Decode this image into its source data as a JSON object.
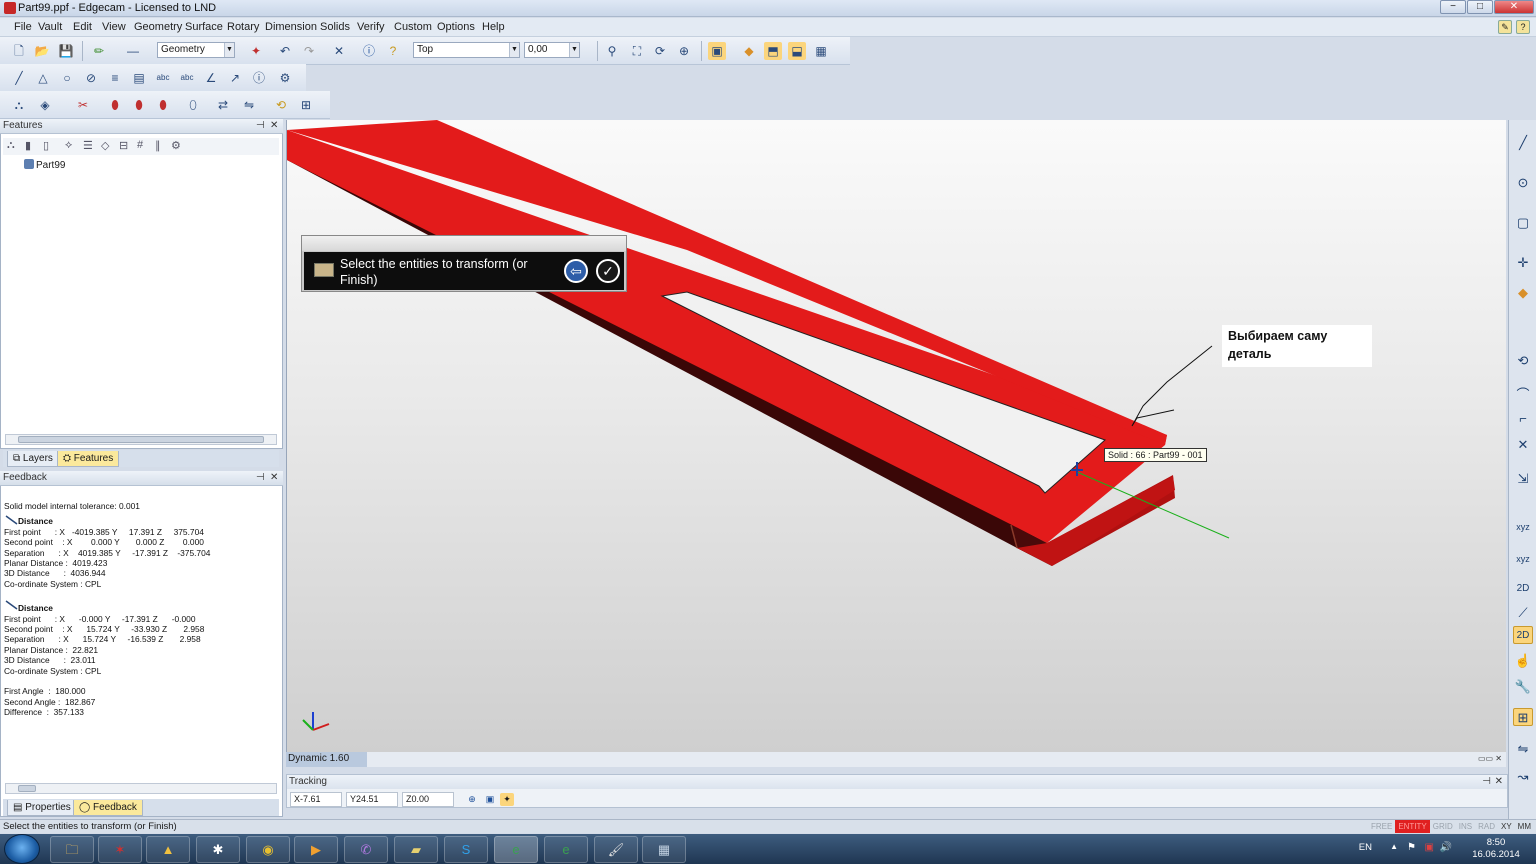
{
  "window": {
    "title": "Part99.ppf - Edgecam - Licensed to LND",
    "min": "−",
    "max": "□",
    "close": "✕"
  },
  "menu": [
    "File",
    "Vault",
    "Edit",
    "View",
    "Geometry",
    "Surface",
    "Rotary",
    "Dimension",
    "Solids",
    "Verify",
    "Custom",
    "Options",
    "Help"
  ],
  "toolbar": {
    "layer_select": "Geometry",
    "view_select": "Top",
    "depth_value": "0,00"
  },
  "features_panel": {
    "title": "Features",
    "tree_root": "Part99",
    "tabs": [
      "Layers",
      "Features"
    ]
  },
  "feedback_panel": {
    "title": "Feedback",
    "tolerance": "Solid model internal tolerance: 0.001",
    "block1": {
      "heading": "Distance",
      "lines": [
        "First point      : X   -4019.385 Y     17.391 Z     375.704",
        "Second point    : X        0.000 Y       0.000 Z        0.000",
        "Separation      : X    4019.385 Y     -17.391 Z    -375.704",
        "Planar Distance :  4019.423",
        "3D Distance      :  4036.944",
        "Co-ordinate System : CPL"
      ]
    },
    "block2": {
      "heading": "Distance",
      "lines": [
        "First point      : X      -0.000 Y     -17.391 Z      -0.000",
        "Second point    : X      15.724 Y     -33.930 Z       2.958",
        "Separation      : X      15.724 Y     -16.539 Z       2.958",
        "Planar Distance :  22.821",
        "3D Distance      :  23.011",
        "Co-ordinate System : CPL"
      ]
    },
    "angles": [
      "First Angle  :  180.000",
      "Second Angle :  182.867",
      "Difference  :  357.133"
    ],
    "tabs": [
      "Properties",
      "Feedback"
    ]
  },
  "viewport": {
    "prompt_text": "Select the entities to transform (or Finish)",
    "annotation": "Выбираем саму деталь",
    "tooltip": "Solid : 66 : Part99 - 001",
    "dynamic_label": "Dynamic 1.60",
    "part_color": "#e31b1b"
  },
  "tracking": {
    "title": "Tracking",
    "x": "X-7.61",
    "y": "Y24.51",
    "z": "Z0.00"
  },
  "status": {
    "message": "Select the entities to transform (or Finish)",
    "flags": [
      "FREE",
      "ENTITY",
      "GRID",
      "INS",
      "RAD",
      "XY",
      "MM"
    ]
  },
  "taskbar": {
    "lang": "EN",
    "time": "8:50",
    "date": "16.06.2014"
  }
}
